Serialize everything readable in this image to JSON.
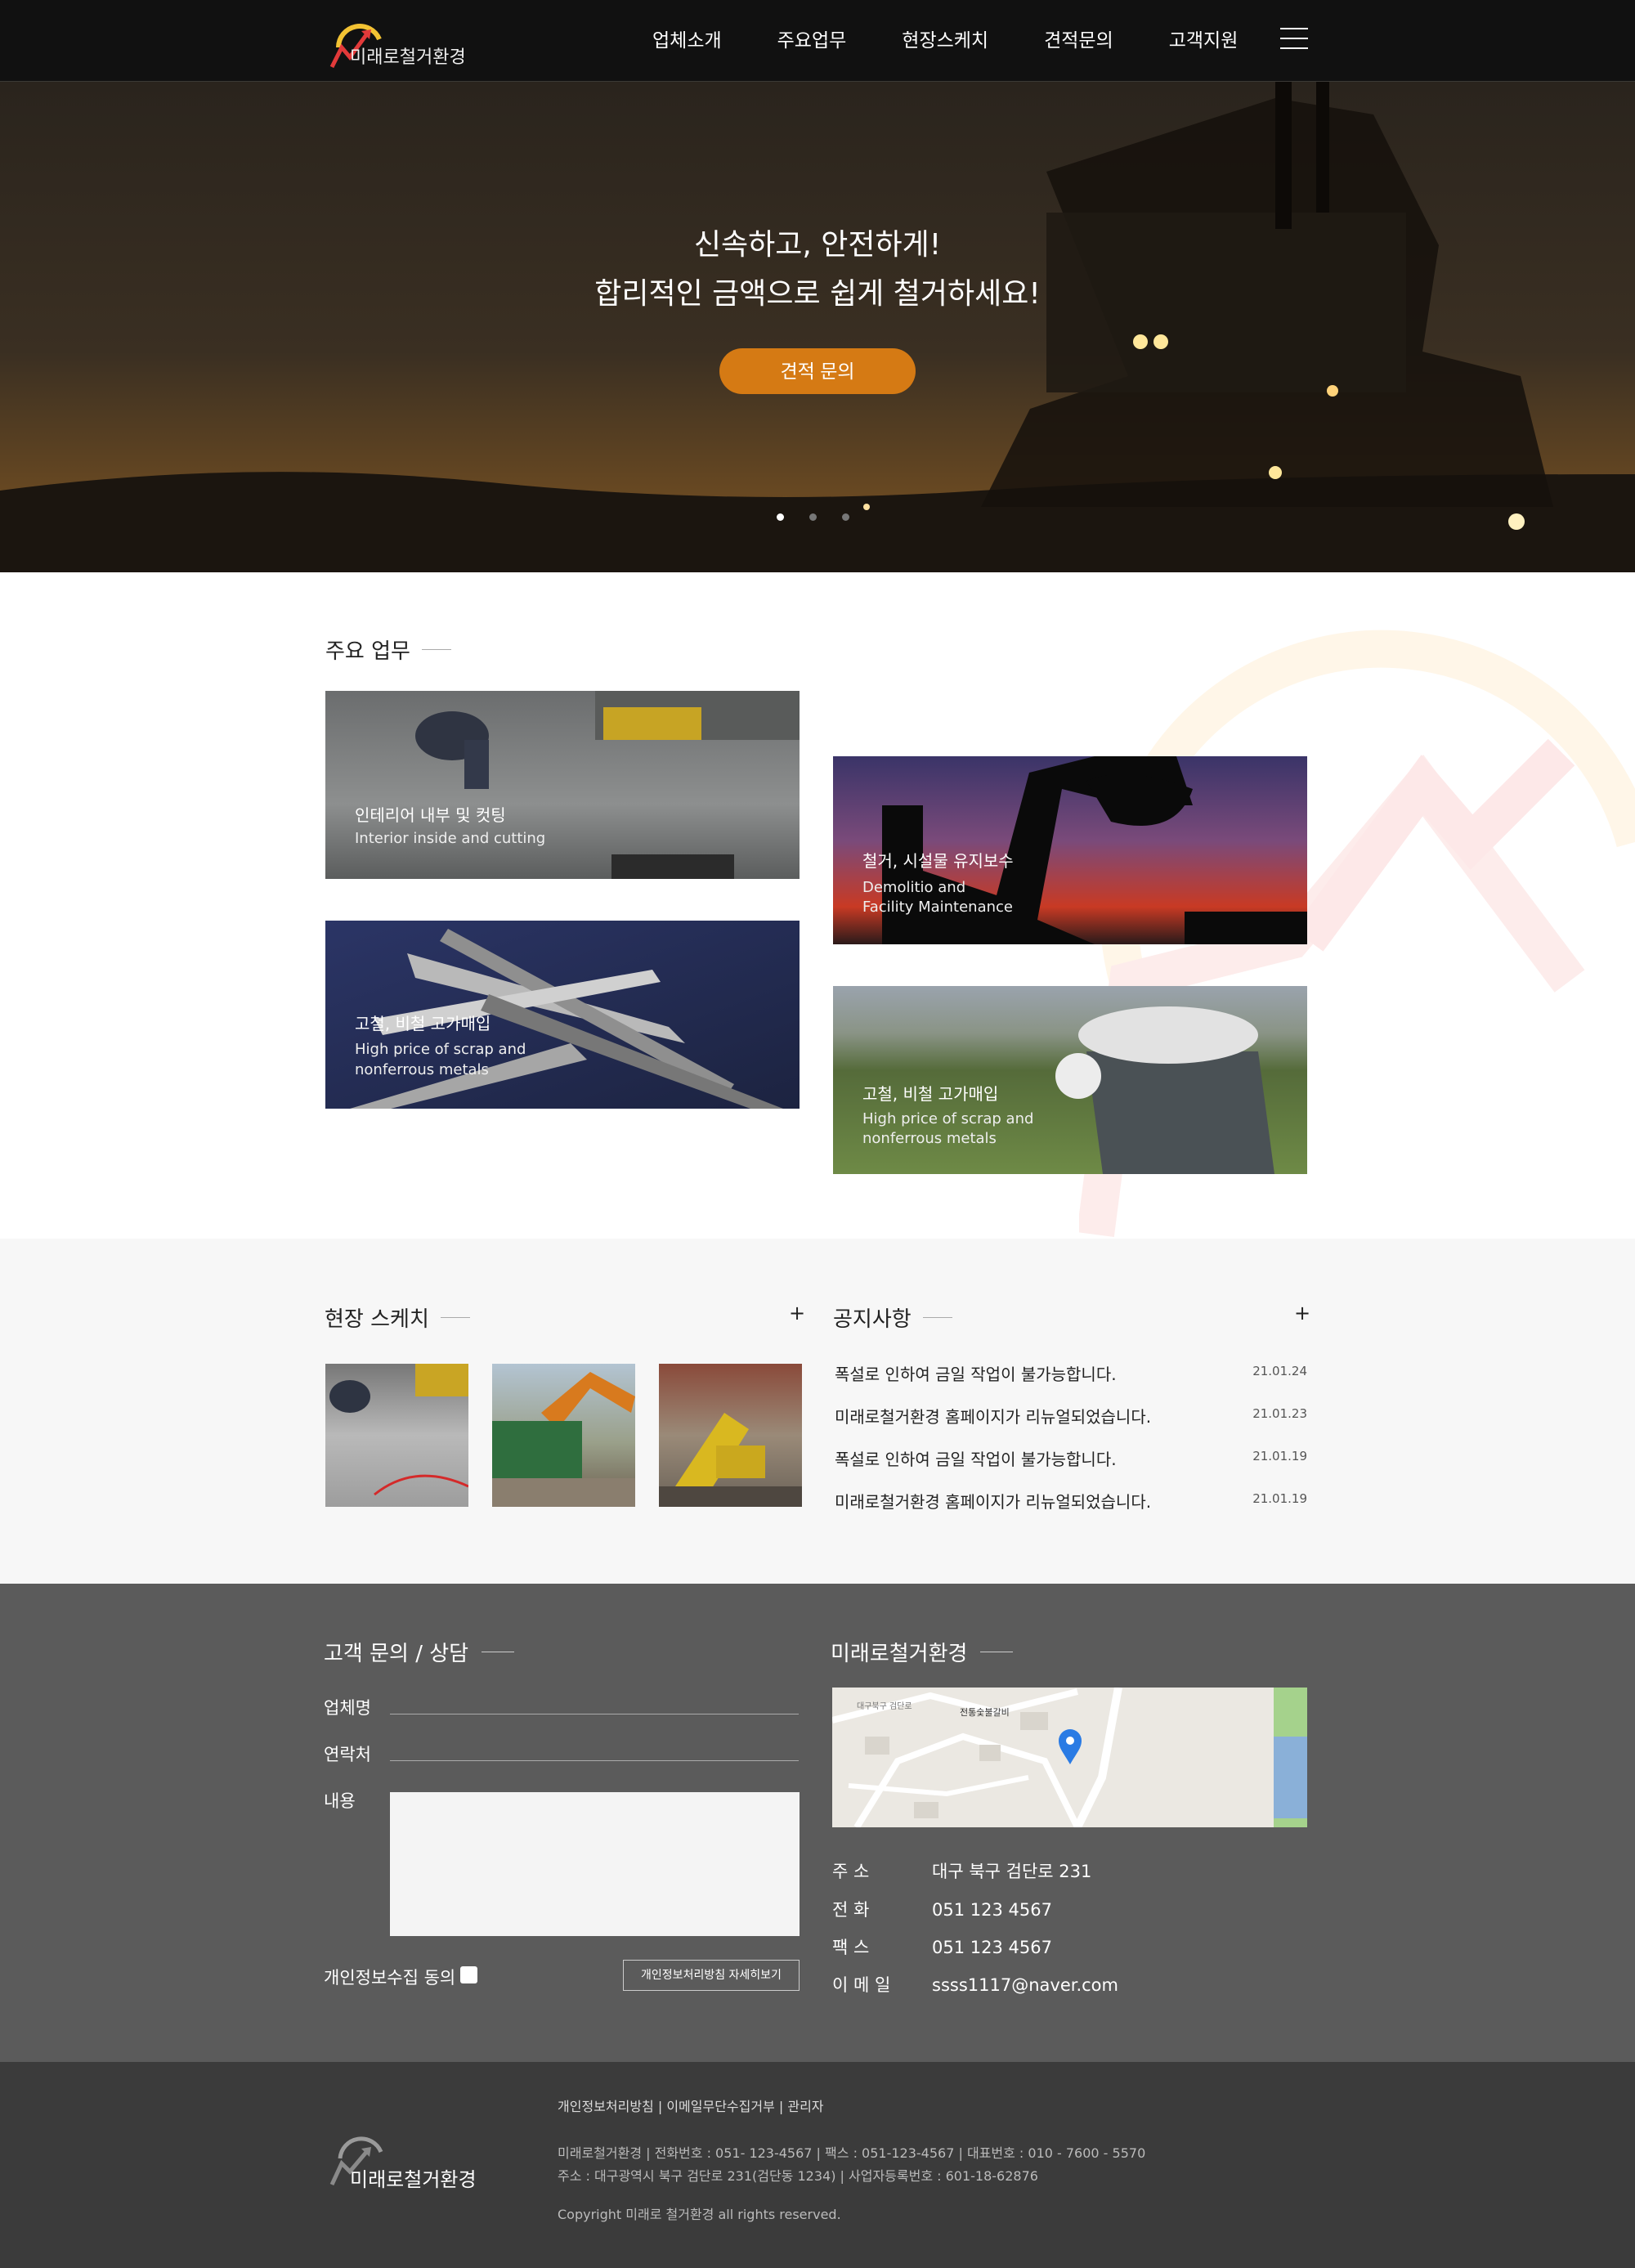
{
  "header": {
    "logo_text": "미래로철거환경",
    "nav": [
      "업체소개",
      "주요업무",
      "현장스케치",
      "견적문의",
      "고객지원"
    ]
  },
  "hero": {
    "line1": "신속하고, 안전하게!",
    "line2": "합리적인 금액으로 쉽게 철거하세요!",
    "button": "견적 문의",
    "slides": 3,
    "active_slide": 1
  },
  "services": {
    "title": "주요 업무",
    "cards": [
      {
        "ko": "인테리어 내부 및 컷팅",
        "en": "Interior inside and cutting"
      },
      {
        "ko": "철거, 시설물 유지보수",
        "en1": "Demolitio and",
        "en2": "Facility Maintenance"
      },
      {
        "ko": "고철, 비철 고가매입",
        "en1": "High price of scrap and",
        "en2": "nonferrous metals"
      },
      {
        "ko": "고철, 비철 고가매입",
        "en1": "High price of scrap and",
        "en2": "nonferrous metals"
      }
    ]
  },
  "sketch": {
    "title": "현장 스케치",
    "more": "+"
  },
  "notice": {
    "title": "공지사항",
    "more": "+",
    "items": [
      {
        "text": "폭설로 인하여 금일 작업이 불가능합니다.",
        "date": "21.01.24"
      },
      {
        "text": "미래로철거환경 홈페이지가 리뉴얼되었습니다.",
        "date": "21.01.23"
      },
      {
        "text": "폭설로 인하여 금일 작업이 불가능합니다.",
        "date": "21.01.19"
      },
      {
        "text": "미래로철거환경 홈페이지가 리뉴얼되었습니다.",
        "date": "21.01.19"
      }
    ]
  },
  "contact": {
    "title": "고객 문의 / 상담",
    "company_label": "업체명",
    "phone_label": "연락처",
    "content_label": "내용",
    "agree_label": "개인정보수집 동의",
    "policy_button": "개인정보처리방침 자세히보기"
  },
  "company": {
    "title": "미래로철거환경",
    "map_place": "전통숯불갈비",
    "map_street": "대구북구 검단로",
    "address_label": "주 소",
    "address": "대구 북구 검단로 231",
    "tel_label": "전 화",
    "tel": "051 123 4567",
    "fax_label": "팩 스",
    "fax": "051 123 4567",
    "email_label": "이 메 일",
    "email": "ssss1117@naver.com"
  },
  "footer": {
    "links": "개인정보처리방침  |  이메일무단수집거부  |  관리자",
    "line1": "미래로철거환경  |  전화번호 : 051- 123-4567  |  팩스 : 051-123-4567  |  대표번호 : 010 - 7600 - 5570",
    "line2": "주소 : 대구광역시 북구 검단로 231(검단동 1234)  |  사업자등록번호 : 601-18-62876",
    "copyright": "Copyright 미래로 철거환경 all rights reserved.",
    "logo_text": "미래로철거환경"
  },
  "colors": {
    "accent": "#d57a14",
    "header_bg": "#111111",
    "contact_bg": "#5b5b5b",
    "footer_bg": "#3b3b3b"
  }
}
